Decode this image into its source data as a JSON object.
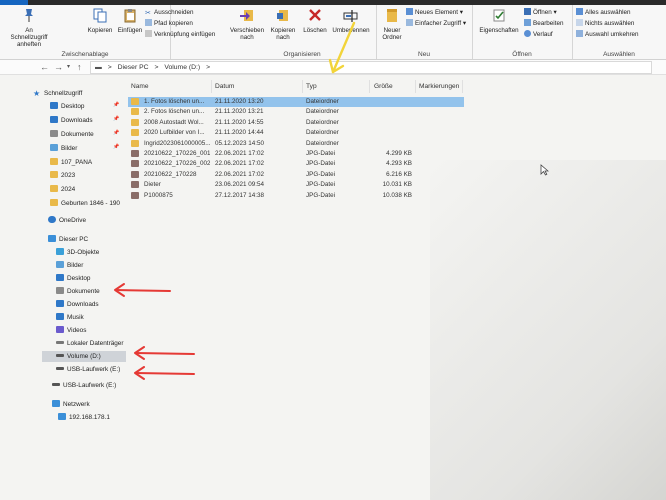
{
  "ribbon": {
    "groups": {
      "clipboard": "Zwischenablage",
      "organize": "Organisieren",
      "new": "Neu",
      "open": "Öffnen",
      "select": "Auswählen"
    },
    "pin_quick": "An Schnellzugriff anheften",
    "copy": "Kopieren",
    "paste": "Einfügen",
    "cut": "Ausschneiden",
    "copy_path": "Pfad kopieren",
    "paste_link": "Verknüpfung einfügen",
    "move_to": "Verschieben nach",
    "copy_to": "Kopieren nach",
    "delete": "Löschen",
    "rename": "Umbenennen",
    "new_folder": "Neuer Ordner",
    "new_item": "Neues Element",
    "easy_access": "Einfacher Zugriff",
    "properties": "Eigenschaften",
    "open_btn": "Öffnen",
    "edit": "Bearbeiten",
    "history": "Verlauf",
    "select_all": "Alles auswählen",
    "select_none": "Nichts auswählen",
    "invert_selection": "Auswahl umkehren"
  },
  "address": {
    "crumbs": [
      "Dieser PC",
      ">",
      "Volume (D:)",
      ">"
    ]
  },
  "sidebar": {
    "quick_access": "Schnellzugriff",
    "items": [
      {
        "label": "Desktop",
        "color": "#2f78c8"
      },
      {
        "label": "Downloads",
        "color": "#2f78c8"
      },
      {
        "label": "Dokumente",
        "color": "#8a8a8a"
      },
      {
        "label": "Bilder",
        "color": "#5aa0d8"
      },
      {
        "label": "107_PANA",
        "color": "#e9b949"
      },
      {
        "label": "2023",
        "color": "#e9b949"
      },
      {
        "label": "2024",
        "color": "#e9b949"
      },
      {
        "label": "Geburten 1846 - 190",
        "color": "#e9b949"
      }
    ],
    "onedrive": "OneDrive",
    "this_pc": "Dieser PC",
    "pc_items": [
      {
        "label": "3D-Objekte",
        "color": "#3aa0d8"
      },
      {
        "label": "Bilder",
        "color": "#5aa0d8"
      },
      {
        "label": "Desktop",
        "color": "#2f78c8"
      },
      {
        "label": "Dokumente",
        "color": "#8a8a8a"
      },
      {
        "label": "Downloads",
        "color": "#2f78c8"
      },
      {
        "label": "Musik",
        "color": "#2f78c8"
      },
      {
        "label": "Videos",
        "color": "#6a5acd"
      },
      {
        "label": "Lokaler Datenträger",
        "color": "#777777"
      },
      {
        "label": "Volume (D:)",
        "color": "#555555"
      },
      {
        "label": "USB-Laufwerk (E:)",
        "color": "#555555"
      }
    ],
    "usb_root": "USB-Laufwerk (E:)",
    "network": "Netzwerk",
    "ip": "192.168.178.1"
  },
  "columns": {
    "name": "Name",
    "date": "Datum",
    "type": "Typ",
    "size": "Größe",
    "tags": "Markierungen"
  },
  "files": [
    {
      "name": "1. Fotos löschen un...",
      "date": "21.11.2020 13:20",
      "type": "Dateiordner",
      "size": "",
      "kind": "folder"
    },
    {
      "name": "2. Fotos löschen un...",
      "date": "21.11.2020 13:21",
      "type": "Dateiordner",
      "size": "",
      "kind": "folder"
    },
    {
      "name": "2008 Autostadt Wol...",
      "date": "21.11.2020 14:55",
      "type": "Dateiordner",
      "size": "",
      "kind": "folder"
    },
    {
      "name": "2020 Lufbilder von I...",
      "date": "21.11.2020 14:44",
      "type": "Dateiordner",
      "size": "",
      "kind": "folder"
    },
    {
      "name": "Ingrid2023061000005...",
      "date": "05.12.2023 14:50",
      "type": "Dateiordner",
      "size": "",
      "kind": "folder"
    },
    {
      "name": "20210622_170226_001",
      "date": "22.06.2021 17:02",
      "type": "JPG-Datei",
      "size": "4.299 KB",
      "kind": "jpg"
    },
    {
      "name": "20210622_170226_002",
      "date": "22.06.2021 17:02",
      "type": "JPG-Datei",
      "size": "4.293 KB",
      "kind": "jpg"
    },
    {
      "name": "20210622_170228",
      "date": "22.06.2021 17:02",
      "type": "JPG-Datei",
      "size": "6.216 KB",
      "kind": "jpg"
    },
    {
      "name": "Dieter",
      "date": "23.06.2021 09:54",
      "type": "JPG-Datei",
      "size": "10.031 KB",
      "kind": "jpg"
    },
    {
      "name": "P1000875",
      "date": "27.12.2017 14:38",
      "type": "JPG-Datei",
      "size": "10.038 KB",
      "kind": "jpg"
    }
  ]
}
